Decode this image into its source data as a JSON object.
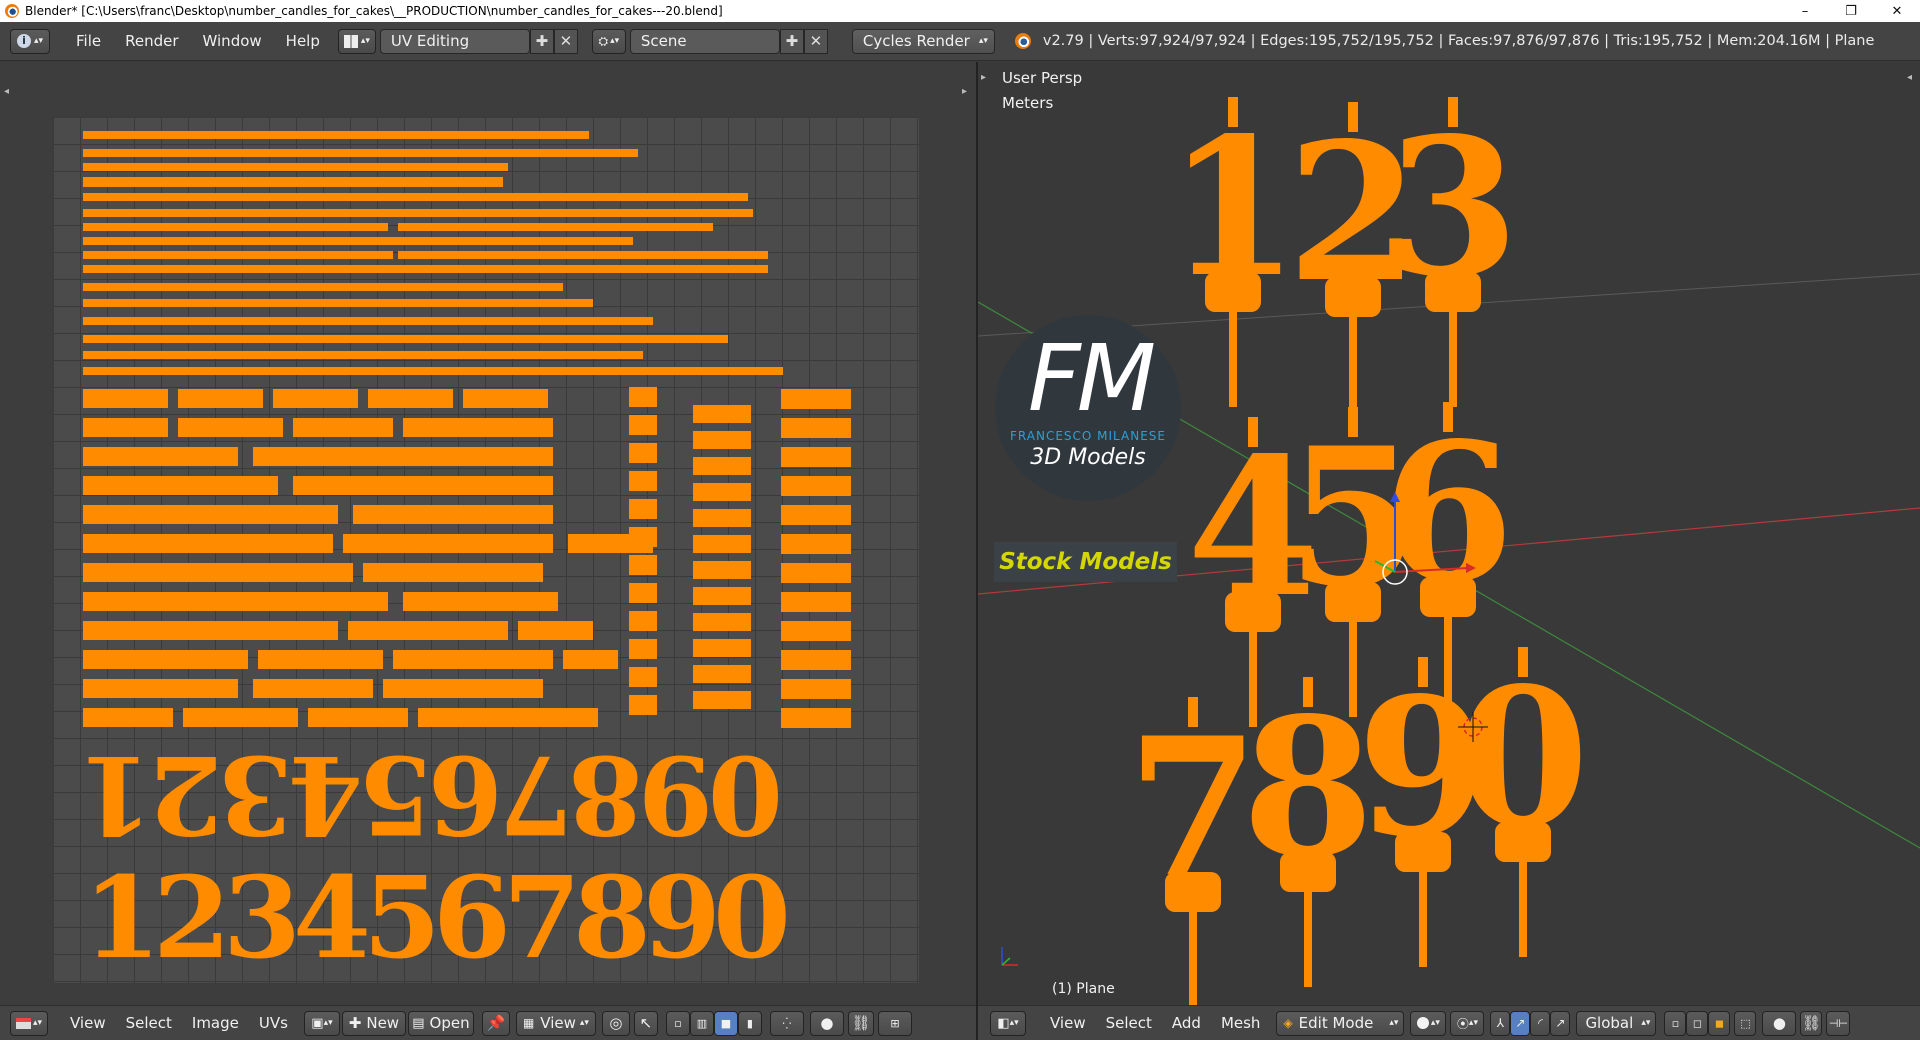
{
  "window": {
    "title": "Blender* [C:\\Users\\franc\\Desktop\\number_candles_for_cakes\\__PRODUCTION\\number_candles_for_cakes---20.blend]",
    "minimize": "–",
    "maximize": "❐",
    "close": "✕"
  },
  "info_header": {
    "editor_icon": "info-icon",
    "menus": [
      "File",
      "Render",
      "Window",
      "Help"
    ],
    "screen_layout": "UV Editing",
    "scene": "Scene",
    "render_engine": "Cycles Render",
    "stats": "v2.79 | Verts:97,924/97,924 | Edges:195,752/195,752 | Faces:97,876/97,876 | Tris:195,752 | Mem:204.16M | Plane"
  },
  "viewport": {
    "view_name": "User Persp",
    "units": "Meters",
    "object_label": "(1) Plane",
    "candle_digits": [
      "1",
      "2",
      "3",
      "4",
      "5",
      "6",
      "7",
      "8",
      "9",
      "0"
    ],
    "wire_color": "#ff8c00",
    "axis_x_color": "#c83232",
    "axis_y_color": "#3c8c3c"
  },
  "uv_editor": {
    "uv_color": "#ff8c00",
    "uv_digits_top": [
      "1",
      "2",
      "3",
      "4",
      "5",
      "6",
      "7",
      "8",
      "9",
      "0"
    ],
    "uv_digits_bottom": [
      "1",
      "2",
      "3",
      "4",
      "5",
      "6",
      "7",
      "8",
      "9",
      "0"
    ]
  },
  "watermark": {
    "logo_letters": "FM",
    "company": "FRANCESCO MILANESE",
    "subtitle": "3D Models",
    "tagline": "Stock Models"
  },
  "uv_bottom_header": {
    "menus": [
      "View",
      "Select",
      "Image",
      "UVs"
    ],
    "new_label": "New",
    "open_label": "Open",
    "view_label": "View"
  },
  "vp_bottom_header": {
    "menus": [
      "View",
      "Select",
      "Add",
      "Mesh"
    ],
    "mode": "Edit Mode",
    "orientation": "Global"
  }
}
